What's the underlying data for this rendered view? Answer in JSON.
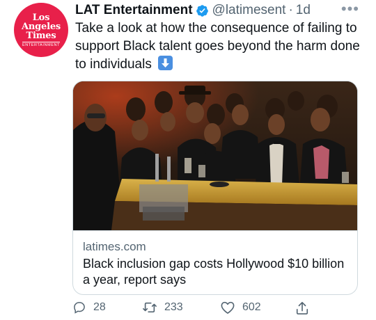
{
  "account": {
    "avatar_lines": [
      "Los",
      "Angeles",
      "Times"
    ],
    "avatar_sub": "ENTERTAINMENT",
    "avatar_color": "#e8204a",
    "name": "LAT Entertainment",
    "verified_icon": "verified-badge-icon",
    "handle": "@latimesent",
    "separator": "·",
    "time": "1d"
  },
  "menu_icon": "more-options-icon",
  "tweet": {
    "text": "Take a look at how the consequence of failing to support Black talent goes beyond the harm done to individuals",
    "emoji": "down-arrow-emoji"
  },
  "card": {
    "domain": "latimes.com",
    "headline": "Black inclusion gap costs Hollywood $10 billion a year, report says"
  },
  "actions": {
    "reply_count": "28",
    "retweet_count": "233",
    "like_count": "602",
    "share_icon": "share-icon"
  },
  "colors": {
    "accent_blue": "#1d9bf0",
    "muted_text": "#536471",
    "brand_red": "#e8204a"
  }
}
